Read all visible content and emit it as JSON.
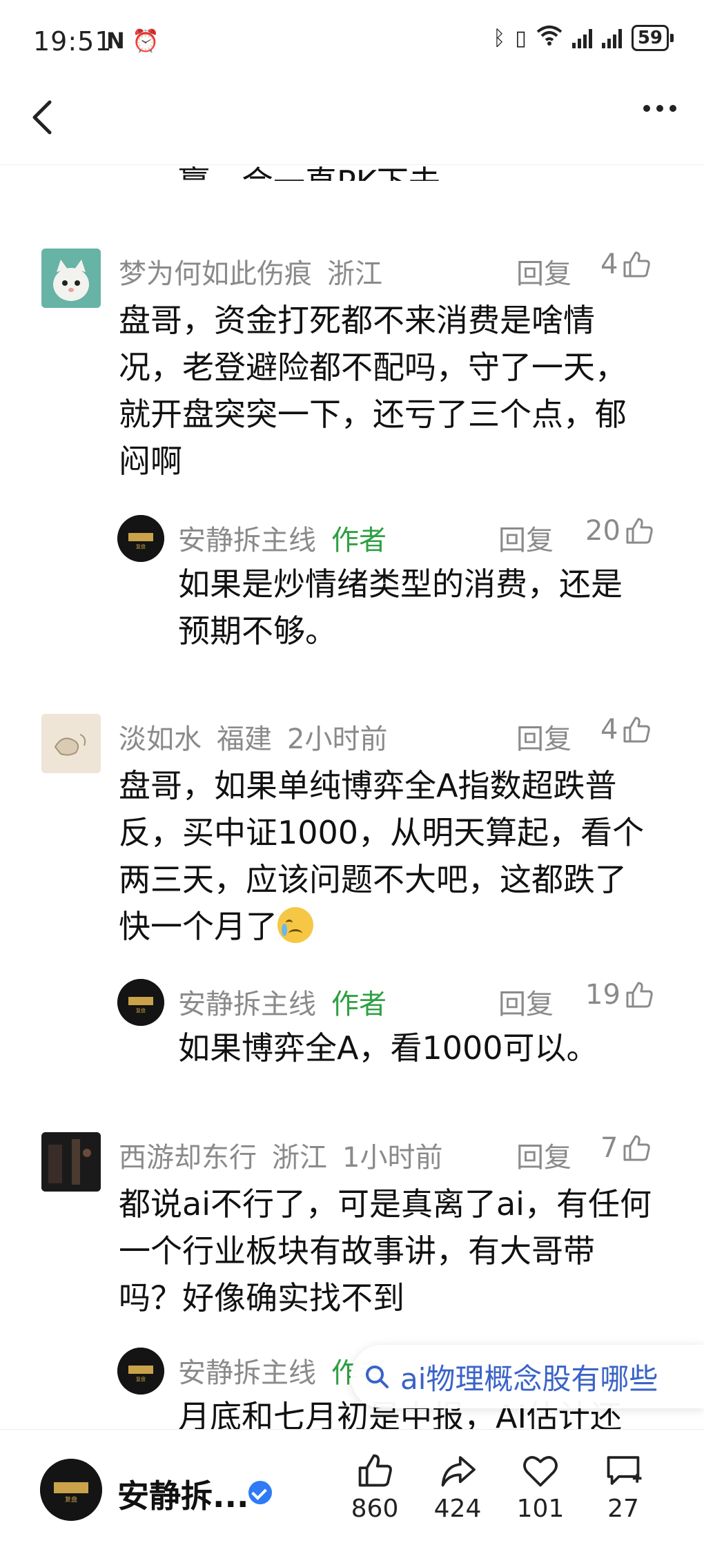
{
  "status_bar": {
    "time": "19:51",
    "battery": "59",
    "left_icons": [
      "nfc-icon",
      "alarm-icon"
    ],
    "right_icons": [
      "bluetooth-icon",
      "vibrate-icon",
      "wifi-icon",
      "signal-icon",
      "signal-icon",
      "battery-icon"
    ]
  },
  "clipped_text": "赢，会一直PK下去。",
  "comments": [
    {
      "user": "梦为何如此伤痕",
      "location": "浙江",
      "time": "",
      "reply_label": "回复",
      "likes": "4",
      "text": "盘哥，资金打死都不来消费是啥情况，老登避险都不配吗，守了一天，就开盘突突一下，还亏了三个点，郁闷啊",
      "lines": [
        "盘哥，资金打死都不来消费是啥情",
        "况，老登避险都不配吗，守了一天，",
        "就开盘突突一下，还亏了三个点，郁",
        "闷啊"
      ],
      "reply": {
        "user": "安静拆主线",
        "tag": "作者",
        "reply_label": "回复",
        "likes": "20",
        "lines": [
          "如果是炒情绪类型的消费，还是",
          "预期不够。"
        ]
      }
    },
    {
      "user": "淡如水",
      "location": "福建",
      "time": "2小时前",
      "reply_label": "回复",
      "likes": "4",
      "lines": [
        "盘哥，如果单纯博弈全A指数超跌普",
        "反，买中证1000，从明天算起，看个",
        "两三天，应该问题不大吧，这都跌了",
        "快一个月了"
      ],
      "reply": {
        "user": "安静拆主线",
        "tag": "作者",
        "reply_label": "回复",
        "likes": "19",
        "lines": [
          "如果博弈全A，看1000可以。"
        ]
      }
    },
    {
      "user": "西游却东行",
      "location": "浙江",
      "time": "1小时前",
      "reply_label": "回复",
      "likes": "7",
      "lines": [
        "都说ai不行了，可是真离了ai，有任何",
        "一个行业板块有故事讲，有大哥带",
        "吗？好像确实找不到"
      ],
      "reply": {
        "user": "安静拆主线",
        "tag": "作者",
        "lines": [
          "月底和七月初是中报，AI估计还"
        ]
      }
    }
  ],
  "search_suggestion": "ai物理概念股有哪些",
  "bottom_bar": {
    "author": "安静拆...",
    "likes": "860",
    "shares": "424",
    "favorites": "101",
    "comments": "27"
  },
  "colors": {
    "author_tag": "#2ea043",
    "meta_gray": "#8a8a8a",
    "search_blue": "#3a63c7",
    "verified_blue": "#2f7bf5"
  }
}
